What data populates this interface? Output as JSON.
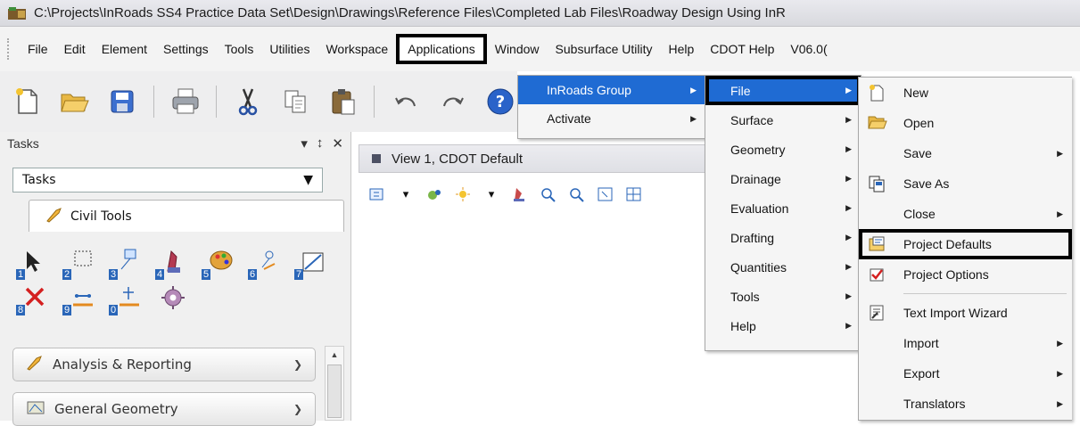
{
  "title_bar": {
    "path": "C:\\Projects\\InRoads SS4 Practice Data Set\\Design\\Drawings\\Reference Files\\Completed Lab Files\\Roadway Design Using InR"
  },
  "menubar": {
    "items": [
      "File",
      "Edit",
      "Element",
      "Settings",
      "Tools",
      "Utilities",
      "Workspace",
      "Applications",
      "Window",
      "Subsurface Utility",
      "Help",
      "CDOT Help",
      "V06.0("
    ]
  },
  "tasks": {
    "header": "Tasks",
    "dropdown": "Tasks",
    "tab": "Civil Tools",
    "tool_numbers": [
      "1",
      "2",
      "3",
      "4",
      "5",
      "6",
      "7",
      "8",
      "9",
      "0"
    ],
    "sections": [
      "Analysis & Reporting",
      "General Geometry"
    ]
  },
  "view": {
    "title": "View 1, CDOT Default"
  },
  "applications_menu": {
    "items": [
      "InRoads Group",
      "Activate"
    ]
  },
  "inroads_menu": {
    "items": [
      "File",
      "Surface",
      "Geometry",
      "Drainage",
      "Evaluation",
      "Drafting",
      "Quantities",
      "Tools",
      "Help"
    ]
  },
  "file_menu": {
    "items": [
      "New",
      "Open",
      "Save",
      "Save As",
      "Close",
      "Project Defaults",
      "Project Options",
      "Text Import Wizard",
      "Import",
      "Export",
      "Translators"
    ]
  },
  "colors": {
    "highlight": "#1f6bd3",
    "annotation_box": "#000000"
  }
}
